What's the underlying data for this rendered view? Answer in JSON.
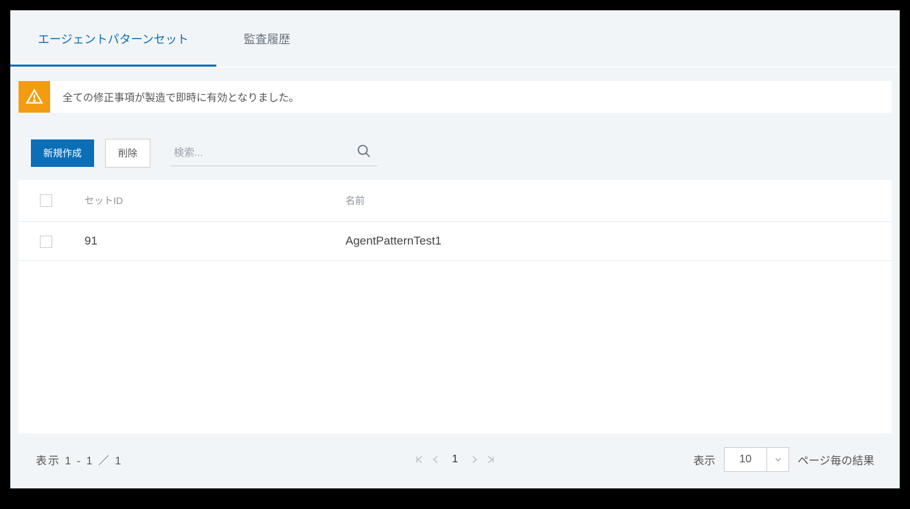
{
  "tabs": [
    {
      "label": "エージェントパターンセット",
      "active": true
    },
    {
      "label": "監査履歴",
      "active": false
    }
  ],
  "notification": {
    "message": "全ての修正事項が製造で即時に有効となりました。"
  },
  "toolbar": {
    "create_label": "新規作成",
    "delete_label": "削除",
    "search_placeholder": "検索..."
  },
  "table": {
    "columns": {
      "set_id": "セットID",
      "name": "名前"
    },
    "rows": [
      {
        "set_id": "91",
        "name": "AgentPatternTest1"
      }
    ]
  },
  "pagination": {
    "showing_text": "表示 1 - 1 ／ 1",
    "current_page": "1",
    "show_label": "表示",
    "page_size": "10",
    "results_label": "ページ毎の結果"
  }
}
